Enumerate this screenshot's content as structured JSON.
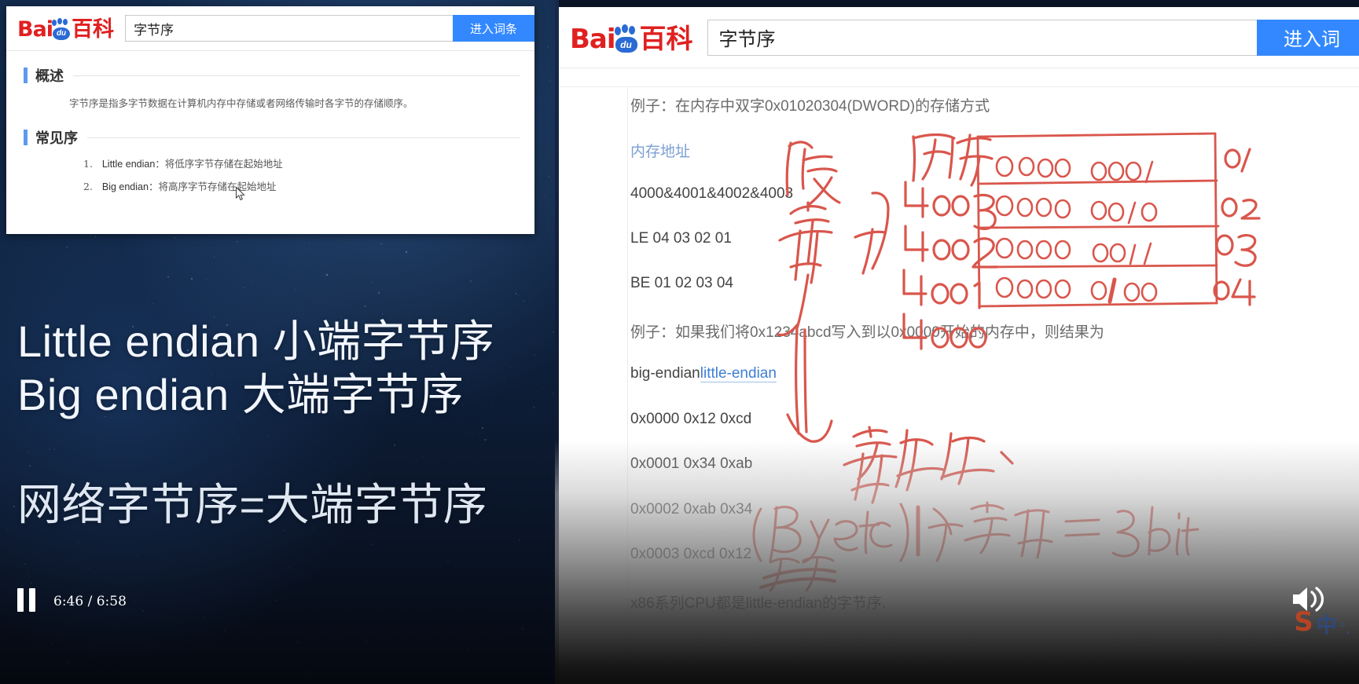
{
  "left_player": {
    "slide": {
      "brand": {
        "bai": "Bai",
        "du": "du",
        "ke": "百科"
      },
      "search_value": "字节序",
      "search_button": "进入词条",
      "sections": [
        {
          "title": "概述",
          "paragraph": "字节序是指多字节数据在计算机内存中存储或者网络传输时各字节的存储顺序。"
        },
        {
          "title": "常见序",
          "items": [
            {
              "num": "1.",
              "term": "Little endian",
              "sep": "：",
              "desc": "将低序字节存储在起始地址"
            },
            {
              "num": "2.",
              "term": "Big endian",
              "sep": "：",
              "desc": "将高序字节存储在起始地址"
            }
          ]
        }
      ]
    },
    "captions": [
      "Little endian 小端字节序",
      "Big endian   大端字节序",
      "网络字节序=大端字节序"
    ],
    "controls": {
      "pause_icon": "pause-icon",
      "time_current": "6:46",
      "time_total": "6:58",
      "time_label": "6:46 / 6:58"
    }
  },
  "right_browser": {
    "brand": {
      "bai": "Bai",
      "du": "du",
      "ke": "百科"
    },
    "search_value": "字节序",
    "search_button": "进入词",
    "lines": [
      {
        "id": "example1",
        "text": "例子：在内存中双字0x01020304(DWORD)的存储方式",
        "style": "grey"
      },
      {
        "id": "memory-address-heading",
        "text": "内存地址",
        "style": "blue"
      },
      {
        "id": "addr-row",
        "text": "4000&4001&4002&4003",
        "style": "dark"
      },
      {
        "id": "le-row",
        "text": "LE 04 03 02 01",
        "style": "dark"
      },
      {
        "id": "be-row",
        "text": "BE 01 02 03 04",
        "style": "dark"
      },
      {
        "id": "example2",
        "text": "例子：如果我们将0x1234abcd写入到以0x0000开始的内存中，则结果为",
        "style": "grey"
      },
      {
        "id": "endian-links",
        "text": "big-endianlittle-endian",
        "style": "link"
      },
      {
        "id": "mem-0000",
        "text": "0x0000 0x12 0xcd",
        "style": "dark"
      },
      {
        "id": "mem-0001",
        "text": "0x0001 0x34 0xab",
        "style": "dark"
      },
      {
        "id": "mem-0002",
        "text": "0x0002 0xab 0x34",
        "style": "dark"
      },
      {
        "id": "mem-0003",
        "text": "0x0003 0xcd 0x12",
        "style": "dark"
      },
      {
        "id": "cpu-note",
        "text": "x86系列CPU都是little-endian的字节序.",
        "style": "dark"
      }
    ],
    "link_big": "big-endian",
    "link_little": "little-endian",
    "annotations": {
      "ink_color": "#d9564c",
      "vertical_note": "低字节",
      "arrow_note": "→",
      "memory_label": "内存",
      "addresses": [
        "4003",
        "4002",
        "4001",
        "4000"
      ],
      "binary_rows": [
        "0000 0001",
        "0000 0010",
        "0000 0011",
        "0000 0100"
      ],
      "byte_labels": [
        "01",
        "02",
        "03",
        "04"
      ],
      "note_unit": "字节为单位、",
      "note_byte": "(Byte)1个字节=8bit",
      "note_struck": "(构成)"
    },
    "volume_icon": "volume-on-icon",
    "ime": {
      "logo": "S",
      "mode": "中",
      "dots": "°,"
    }
  }
}
